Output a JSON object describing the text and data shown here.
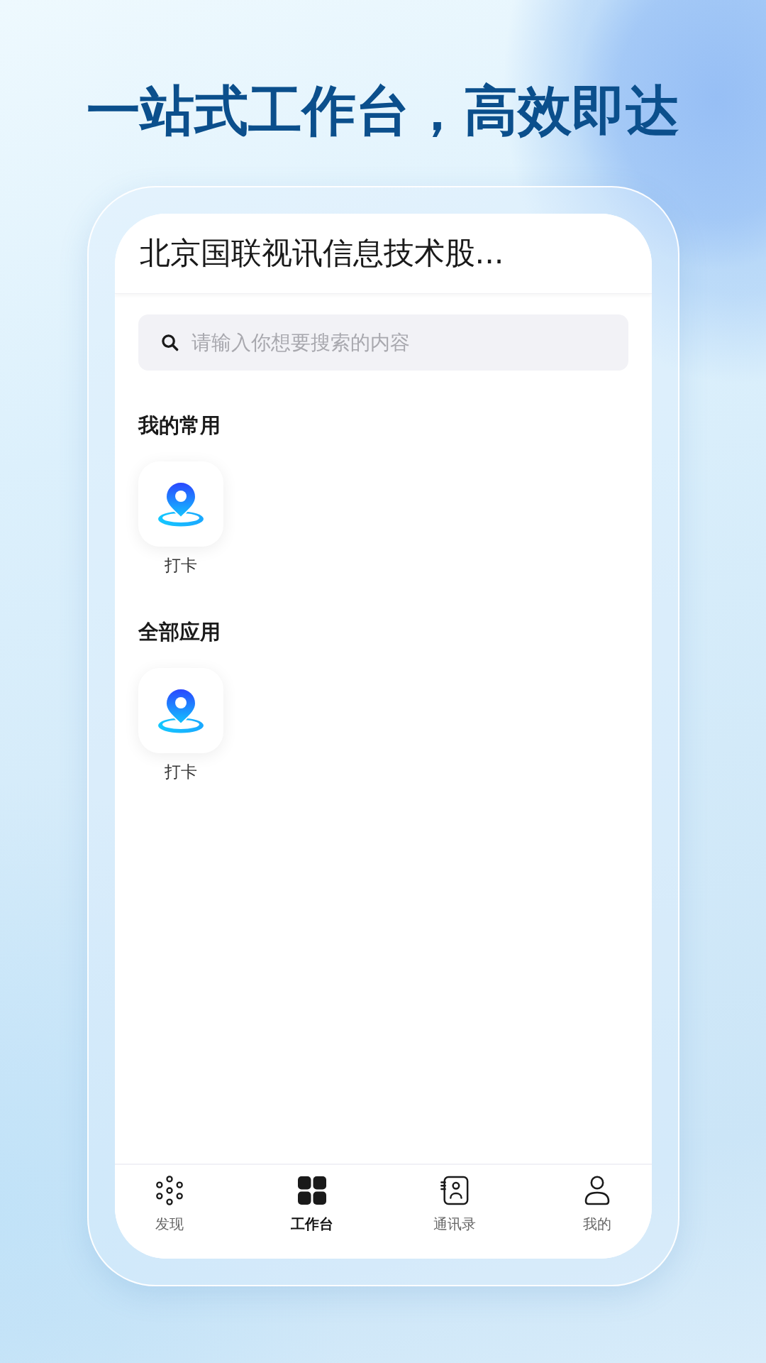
{
  "headline": "一站式工作台，高效即达",
  "header": {
    "title": "北京国联视讯信息技术股..."
  },
  "search": {
    "placeholder": "请输入你想要搜索的内容"
  },
  "sections": [
    {
      "title": "我的常用",
      "apps": [
        {
          "label": "打卡"
        }
      ]
    },
    {
      "title": "全部应用",
      "apps": [
        {
          "label": "打卡"
        }
      ]
    }
  ],
  "tab_bar": [
    {
      "label": "发现",
      "kind": "discover",
      "selected": false
    },
    {
      "label": "工作台",
      "kind": "workbench",
      "selected": true
    },
    {
      "label": "通讯录",
      "kind": "contacts",
      "selected": false
    },
    {
      "label": "我的",
      "kind": "profile",
      "selected": false
    }
  ]
}
